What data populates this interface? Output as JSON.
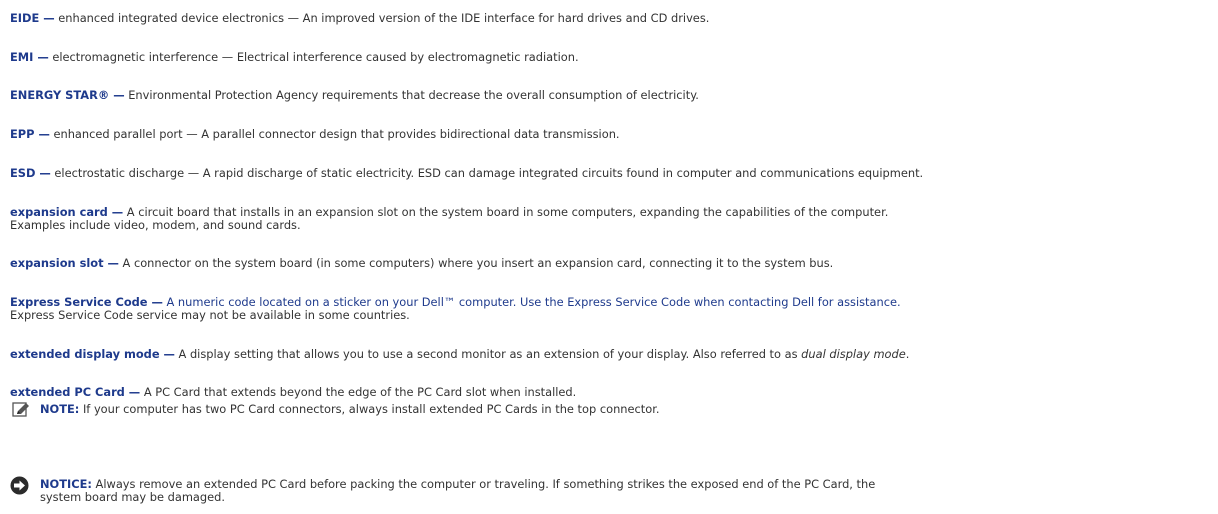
{
  "entries": [
    {
      "term": "EIDE —",
      "text": " enhanced integrated device electronics — An improved version of the IDE interface for hard drives and CD drives."
    },
    {
      "term": "EMI —",
      "text": " electromagnetic interference — Electrical interference caused by electromagnetic radiation."
    },
    {
      "term": "ENERGY STAR® —",
      "text": " Environmental Protection Agency requirements that decrease the overall consumption of electricity."
    },
    {
      "term": "EPP —",
      "text": " enhanced parallel port — A parallel connector design that provides bidirectional data transmission."
    },
    {
      "term": "ESD —",
      "text": " electrostatic discharge — A rapid discharge of static electricity. ESD can damage integrated circuits found in computer and communications equipment."
    },
    {
      "term": "expansion card —",
      "text": " A circuit board that installs in an expansion slot on the system board in some computers, expanding the capabilities of the computer.",
      "text2": "Examples include video, modem, and sound cards."
    },
    {
      "term": "expansion slot —",
      "text": " A connector on the system board (in some computers) where you insert an expansion card, connecting it to the system bus."
    },
    {
      "term": "Express Service Code —",
      "text_bold": " A numeric code located on a sticker on your Dell™ computer. Use the Express Service Code when contacting Dell for assistance.",
      "text2": "Express Service Code service may not be available in some countries."
    },
    {
      "term": "extended display mode —",
      "text": " A display setting that allows you to use a second monitor as an extension of your display. Also referred to as ",
      "text_italic": "dual display mode",
      "text_end": "."
    },
    {
      "term": "extended PC Card —",
      "text": " A PC Card that extends beyond the edge of the PC Card slot when installed."
    }
  ],
  "note": {
    "icon": "pencil-note-icon",
    "label": "NOTE:",
    "text": " If your computer has two PC Card connectors, always install extended PC Cards in the top connector."
  },
  "notice": {
    "icon": "notice-arrow-icon",
    "label": "NOTICE:",
    "text": " Always remove an extended PC Card before packing the computer or traveling. If something strikes the exposed end of the PC Card, the",
    "text2": "system board may be damaged."
  }
}
